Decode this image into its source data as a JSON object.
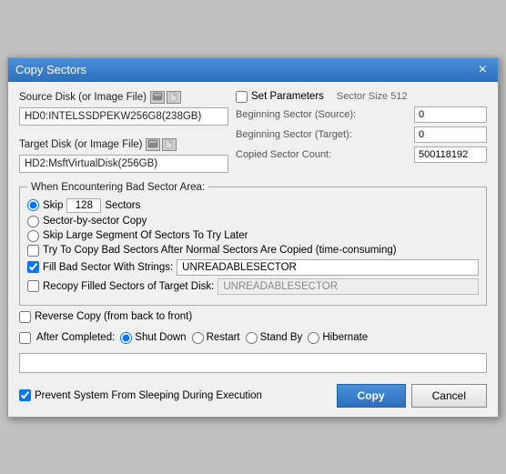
{
  "title_bar": {
    "title": "Copy Sectors",
    "close_label": "×"
  },
  "source_disk": {
    "label": "Source Disk (or Image File)",
    "value": "HD0:INTELSSDPEKW256G8(238GB)"
  },
  "target_disk": {
    "label": "Target Disk (or Image File)",
    "value": "HD2:MsftVirtualDisk(256GB)"
  },
  "set_parameters": {
    "label": "Set Parameters",
    "sector_size_label": "Sector Size 512",
    "beginning_source_label": "Beginning Sector (Source):",
    "beginning_source_value": "0",
    "beginning_target_label": "Beginning Sector (Target):",
    "beginning_target_value": "0",
    "copied_count_label": "Copied Sector Count:",
    "copied_count_value": "500118192"
  },
  "bad_sector_group": {
    "label": "When Encountering Bad Sector Area:"
  },
  "skip_option": {
    "label": "Skip",
    "value": "128",
    "suffix": "Sectors"
  },
  "sector_by_sector": {
    "label": "Sector-by-sector Copy"
  },
  "skip_large": {
    "label": "Skip Large Segment Of Sectors To Try Later"
  },
  "try_copy_bad": {
    "label": "Try To Copy Bad Sectors After Normal Sectors Are Copied (time-consuming)"
  },
  "fill_bad": {
    "label": "Fill Bad Sector With Strings:",
    "value": "UNREADABLESECTOR",
    "checked": true
  },
  "recopy_filled": {
    "label": "Recopy Filled Sectors of Target Disk:",
    "value": "UNREADABLESECTOR",
    "checked": false
  },
  "reverse_copy": {
    "label": "Reverse Copy (from back to front)",
    "checked": false
  },
  "after_completed": {
    "label": "After Completed:",
    "checked": false,
    "options": [
      {
        "label": "Shut Down",
        "selected": true
      },
      {
        "label": "Restart",
        "selected": false
      },
      {
        "label": "Stand By",
        "selected": false
      },
      {
        "label": "Hibernate",
        "selected": false
      }
    ]
  },
  "prevent_sleeping": {
    "label": "Prevent System From Sleeping During Execution",
    "checked": true
  },
  "buttons": {
    "copy": "Copy",
    "cancel": "Cancel"
  }
}
